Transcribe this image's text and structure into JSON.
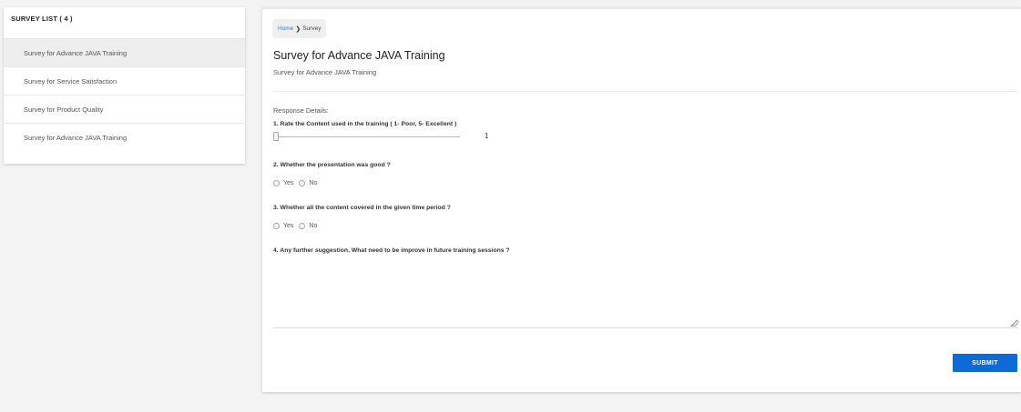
{
  "sidebar": {
    "title": "SURVEY LIST ( 4 )",
    "items": [
      {
        "label": "Survey for Advance JAVA Training"
      },
      {
        "label": "Survey for Service Satisfaction"
      },
      {
        "label": "Survey for Product Quality"
      },
      {
        "label": "Survey for Advance JAVA Training"
      }
    ]
  },
  "breadcrumb": {
    "home": "Home",
    "separator": "❯",
    "current": "Survey"
  },
  "survey": {
    "title": "Survey for Advance JAVA Training",
    "subtitle": "Survey for Advance JAVA Training",
    "response_label": "Response Details:",
    "q1": {
      "text": "1.  Rate the Content used in the training ( 1- Poor, 5- Excellent )",
      "value": "1",
      "min": 1,
      "max": 5
    },
    "q2": {
      "text": "2.  Whether the presentation was good ?",
      "yes": "Yes",
      "no": "No"
    },
    "q3": {
      "text": "3.  Whether all the content covered in the given time period ?",
      "yes": "Yes",
      "no": "No"
    },
    "q4": {
      "text": "4.  Any further suggestion, What need to be improve in future training sessions ?",
      "value": ""
    },
    "submit_label": "SUBMIT"
  },
  "colors": {
    "accent": "#0e6ad6",
    "link": "#3a7bd5",
    "background": "#f3f3f3"
  }
}
